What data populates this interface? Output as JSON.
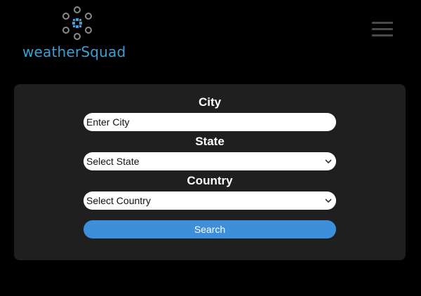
{
  "header": {
    "logo_text": "weatherSquad",
    "logo_icon": "weathersquad-logo-icon",
    "menu_icon": "hamburger-menu-icon"
  },
  "form": {
    "city": {
      "label": "City",
      "placeholder": "Enter City"
    },
    "state": {
      "label": "State",
      "selected": "Select State"
    },
    "country": {
      "label": "Country",
      "selected": "Select Country"
    },
    "search_label": "Search"
  },
  "colors": {
    "background": "#000000",
    "panel": "#1f1f1f",
    "brand": "#3e9fd6",
    "button": "#3d8fd9"
  }
}
